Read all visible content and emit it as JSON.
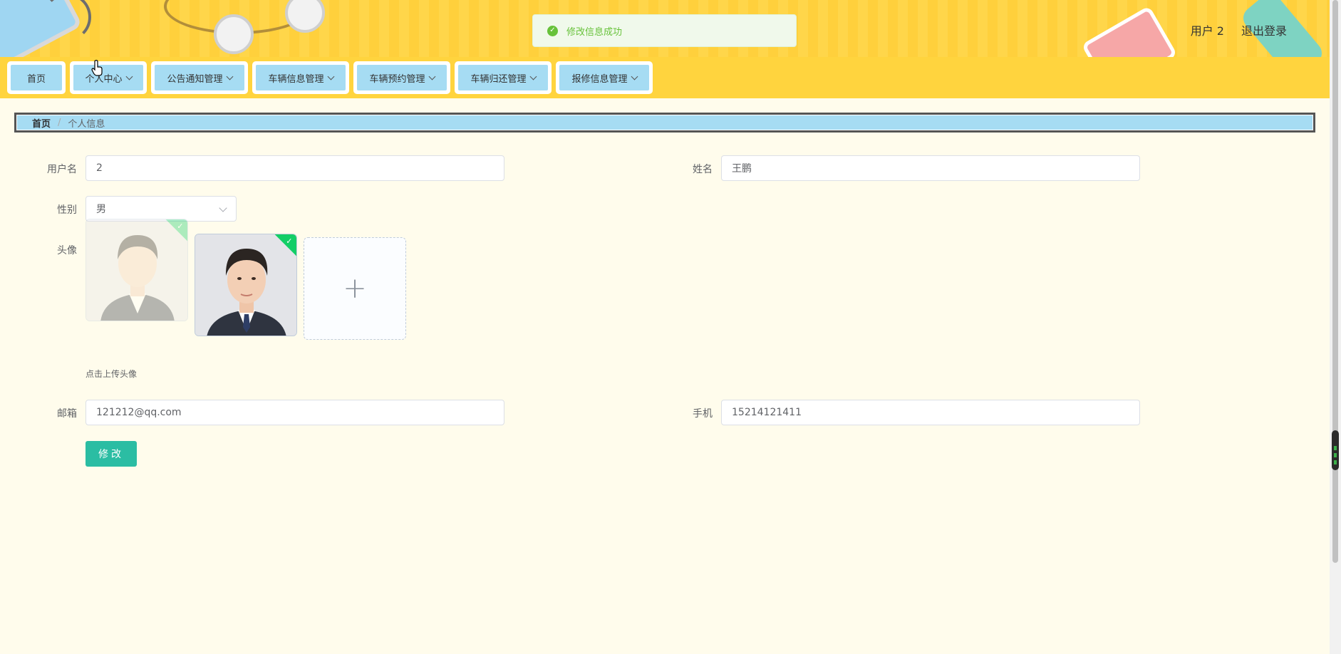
{
  "header": {
    "user_label": "用户 2",
    "logout_label": "退出登录"
  },
  "toast": {
    "message": "修改信息成功",
    "color": "#67c23a"
  },
  "nav": {
    "items": [
      {
        "label": "首页",
        "dropdown": false
      },
      {
        "label": "个人中心",
        "dropdown": true
      },
      {
        "label": "公告通知管理",
        "dropdown": true
      },
      {
        "label": "车辆信息管理",
        "dropdown": true
      },
      {
        "label": "车辆预约管理",
        "dropdown": true
      },
      {
        "label": "车辆归还管理",
        "dropdown": true
      },
      {
        "label": "报修信息管理",
        "dropdown": true
      }
    ]
  },
  "breadcrumb": {
    "home": "首页",
    "separator": "/",
    "current": "个人信息"
  },
  "form": {
    "username": {
      "label": "用户名",
      "value": "2"
    },
    "name": {
      "label": "姓名",
      "value": "王鹏"
    },
    "gender": {
      "label": "性别",
      "value": "男"
    },
    "avatar": {
      "label": "头像",
      "tip": "点击上传头像"
    },
    "email": {
      "label": "邮箱",
      "value": "121212@qq.com"
    },
    "phone": {
      "label": "手机",
      "value": "15214121411"
    },
    "submit_label": "修改"
  },
  "colors": {
    "nav_bg": "#ffd43e",
    "nav_item_bg": "#a6dcf3",
    "page_bg": "#fffcec",
    "button": "#2bbda3",
    "success": "#13ce66"
  }
}
